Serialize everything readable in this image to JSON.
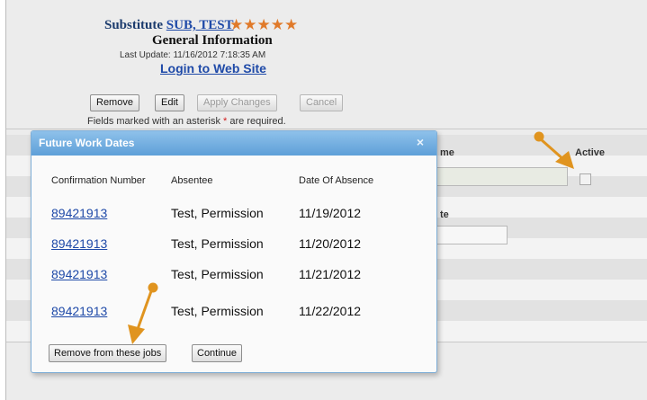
{
  "profile": {
    "title_prefix": "Substitute",
    "name_link": "SUB, TEST",
    "rating_stars": "★★★★★",
    "section_title": "General Information",
    "last_update": "Last Update: 11/16/2012 7:18:35 AM",
    "login_link": "Login to Web Site"
  },
  "toolbar": {
    "remove_label": "Remove",
    "edit_label": "Edit",
    "apply_label": "Apply Changes",
    "cancel_label": "Cancel",
    "required_prefix": "Fields marked with an asterisk",
    "required_asterisk": "*",
    "required_suffix": "are required."
  },
  "form": {
    "name_header_partial": "me",
    "active_header": "Active",
    "date_header_partial": "te"
  },
  "modal": {
    "title": "Future Work Dates",
    "close_glyph": "×",
    "columns": [
      "Confirmation Number",
      "Absentee",
      "Date Of Absence"
    ],
    "rows": [
      {
        "confirmation": "89421913",
        "absentee": "Test, Permission",
        "date": "11/19/2012"
      },
      {
        "confirmation": "89421913",
        "absentee": "Test, Permission",
        "date": "11/20/2012"
      },
      {
        "confirmation": "89421913",
        "absentee": "Test, Permission",
        "date": "11/21/2012"
      },
      {
        "confirmation": "89421913",
        "absentee": "Test, Permission",
        "date": "11/22/2012"
      }
    ],
    "remove_button": "Remove from these jobs",
    "continue_button": "Continue"
  },
  "colors": {
    "accent_link": "#1f4aa8",
    "modal_header": "#5e9fd8",
    "callout_orange": "#e0941f",
    "star_orange": "#e07a2a"
  }
}
